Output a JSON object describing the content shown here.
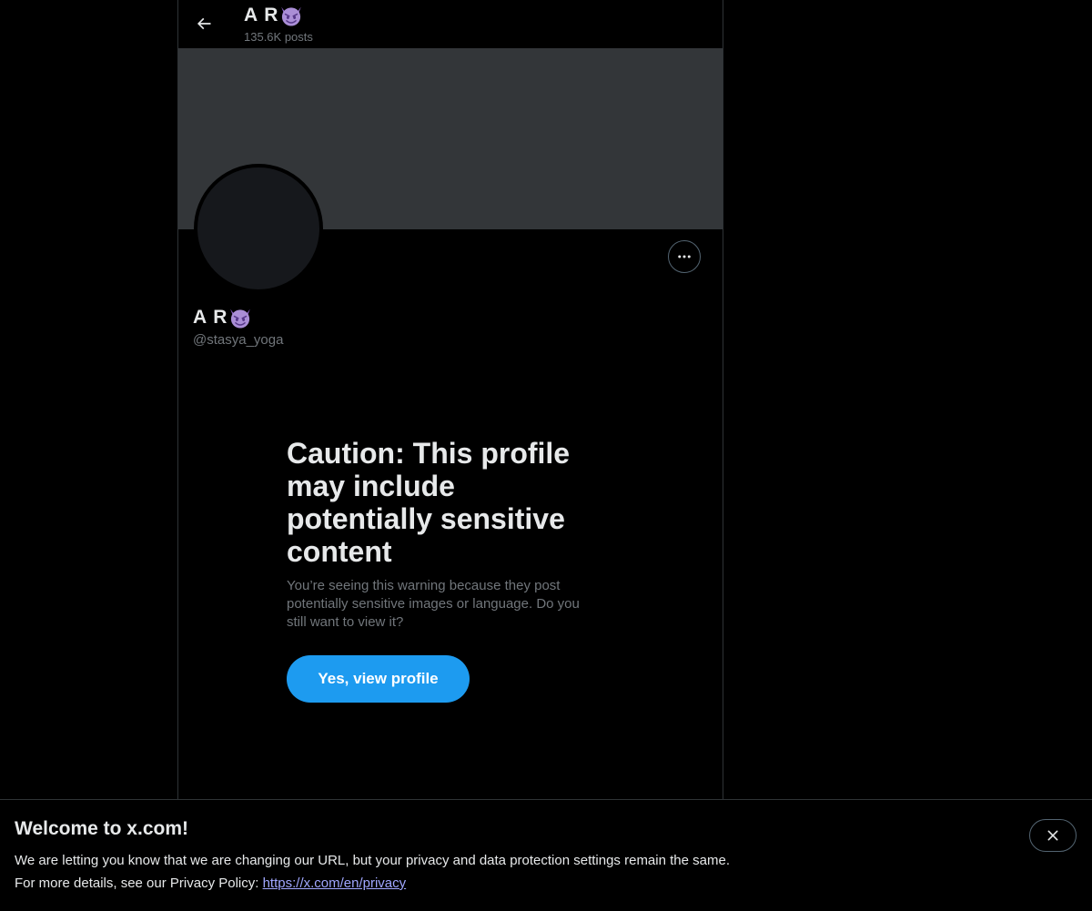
{
  "header": {
    "title": "A R",
    "posts_count": "135.6K posts",
    "title_emoji_icon": "smiling-devil-icon"
  },
  "profile": {
    "name": "A R",
    "handle": "@stasya_yoga",
    "name_emoji_icon": "smiling-devil-icon",
    "banner_color": "#333639"
  },
  "caution": {
    "title": "Caution: This profile may include potentially sensitive content",
    "message": "You’re seeing this warning because they post potentially sensitive images or language. Do you still want to view it?",
    "view_button": "Yes, view profile"
  },
  "welcome_banner": {
    "title": "Welcome to x.com!",
    "line1": "We are letting you know that we are changing our URL, but your privacy and data protection settings remain the same.",
    "line2_prefix": "For more details, see our Privacy Policy: ",
    "privacy_link": "https://x.com/en/privacy"
  },
  "colors": {
    "accent": "#1d9bf0",
    "background": "#000000",
    "muted_text": "#71767b",
    "link": "#a0a7ff"
  }
}
